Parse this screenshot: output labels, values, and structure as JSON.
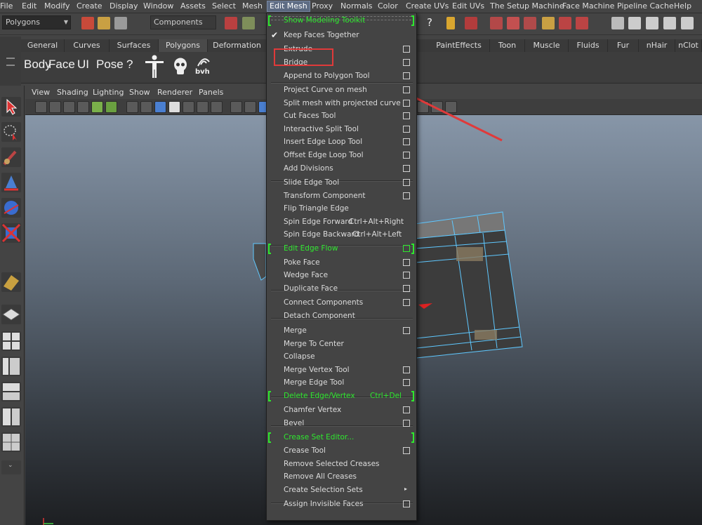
{
  "menubar": {
    "items": [
      "File",
      "Edit",
      "Modify",
      "Create",
      "Display",
      "Window",
      "Assets",
      "Select",
      "Mesh",
      "Edit Mesh",
      "Proxy",
      "Normals",
      "Color",
      "Create UVs",
      "Edit UVs",
      "The Setup Machine",
      "Face Machine",
      "Pipeline Cache",
      "Help"
    ]
  },
  "statusline": {
    "mode_select": "Polygons",
    "components_label": "Components",
    "help_glyph": "?"
  },
  "shelf": {
    "tabs": [
      "General",
      "Curves",
      "Surfaces",
      "Polygons",
      "Deformation",
      "PaintEffects",
      "Toon",
      "Muscle",
      "Fluids",
      "Fur",
      "nHair",
      "nClot"
    ],
    "items": {
      "body": "Body",
      "face": "Face",
      "ui": "UI",
      "pose": "Pose",
      "question": "?",
      "bvh": "bvh"
    }
  },
  "panel": {
    "menu": [
      "View",
      "Shading",
      "Lighting",
      "Show",
      "Renderer",
      "Panels"
    ]
  },
  "edit_mesh_menu": {
    "items": [
      {
        "label": "Show Modeling Toolkit",
        "green": true,
        "brackets": true
      },
      {
        "label": "Keep Faces Together",
        "checked": true
      },
      {
        "label": "Extrude",
        "option": true
      },
      {
        "label": "Bridge",
        "option": true
      },
      {
        "label": "Append to Polygon Tool",
        "option": true
      },
      {
        "label": "Project Curve on mesh",
        "option": true
      },
      {
        "label": "Split mesh with projected curve",
        "option": true
      },
      {
        "label": "Cut Faces Tool",
        "option": true
      },
      {
        "label": "Interactive Split Tool",
        "option": true
      },
      {
        "label": "Insert Edge Loop Tool",
        "option": true
      },
      {
        "label": "Offset Edge Loop Tool",
        "option": true
      },
      {
        "label": "Add Divisions",
        "option": true
      },
      {
        "label": "Slide Edge Tool",
        "option": true
      },
      {
        "label": "Transform Component",
        "option": true
      },
      {
        "label": "Flip Triangle Edge"
      },
      {
        "label": "Spin Edge Forward",
        "shortcut": "Ctrl+Alt+Right"
      },
      {
        "label": "Spin Edge Backward",
        "shortcut": "Ctrl+Alt+Left"
      },
      {
        "label": "Edit Edge Flow",
        "green": true,
        "brackets": true,
        "option": true
      },
      {
        "label": "Poke Face",
        "option": true
      },
      {
        "label": "Wedge Face",
        "option": true
      },
      {
        "label": "Duplicate Face",
        "option": true
      },
      {
        "label": "Connect Components",
        "option": true
      },
      {
        "label": "Detach Component"
      },
      {
        "label": "Merge",
        "option": true
      },
      {
        "label": "Merge To Center"
      },
      {
        "label": "Collapse"
      },
      {
        "label": "Merge Vertex Tool",
        "option": true
      },
      {
        "label": "Merge Edge Tool",
        "option": true
      },
      {
        "label": "Delete Edge/Vertex",
        "shortcut": "Ctrl+Del",
        "green": true,
        "brackets": true
      },
      {
        "label": "Chamfer Vertex",
        "option": true
      },
      {
        "label": "Bevel",
        "option": true
      },
      {
        "label": "Crease Set Editor...",
        "green": true,
        "brackets": true
      },
      {
        "label": "Crease Tool",
        "option": true
      },
      {
        "label": "Remove Selected Creases"
      },
      {
        "label": "Remove All Creases"
      },
      {
        "label": "Create Selection Sets",
        "submenu": true
      },
      {
        "label": "Assign Invisible Faces",
        "option": true
      }
    ]
  },
  "colors": {
    "accent_green": "#2ee82e",
    "annotation_red": "#e03a3a",
    "menu_active": "#5e6c84"
  }
}
